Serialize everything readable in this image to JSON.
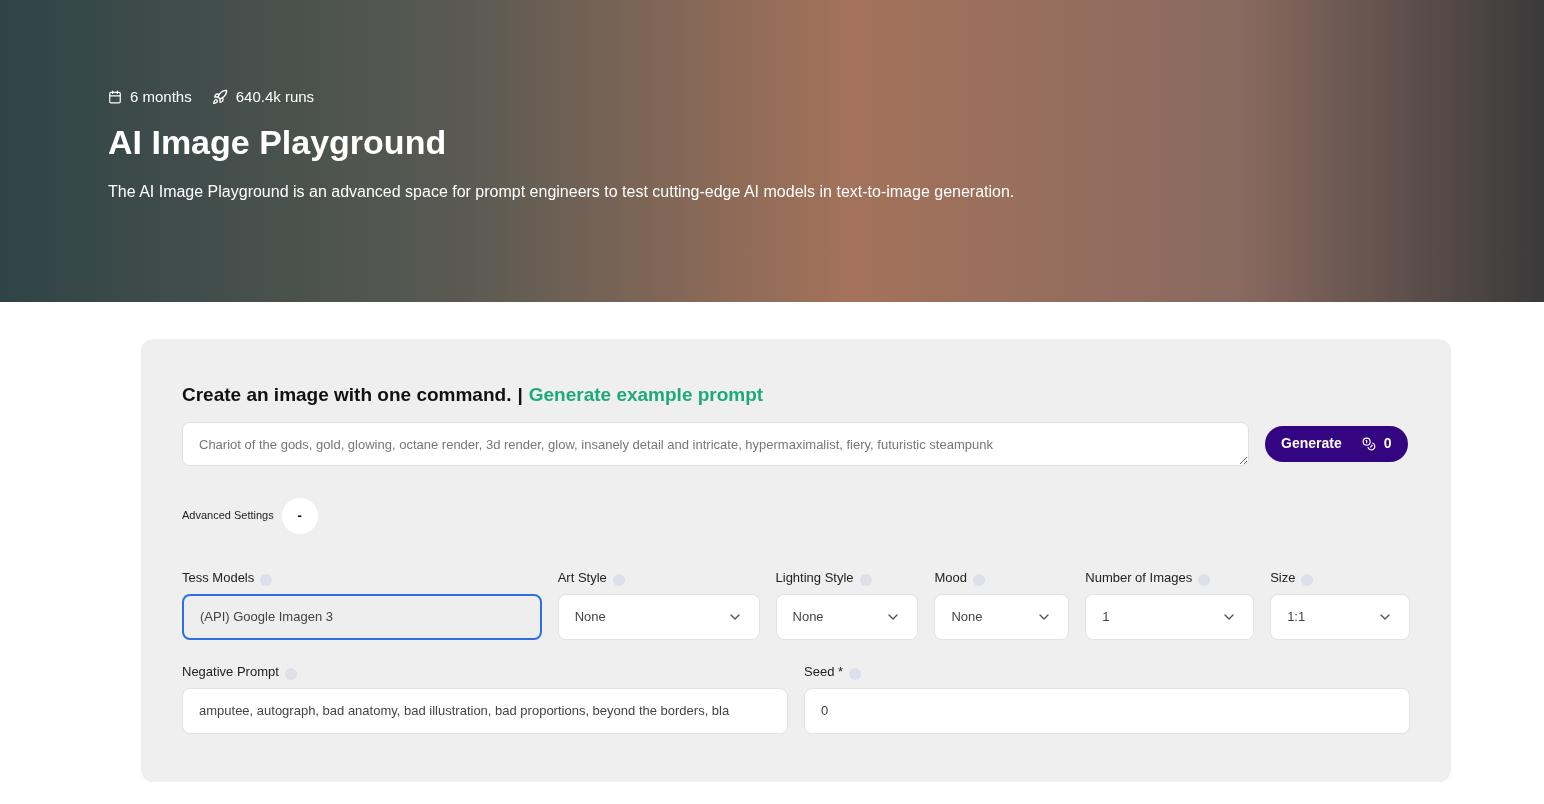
{
  "hero": {
    "stats": [
      {
        "kind": "calendar",
        "text": "6 months"
      },
      {
        "kind": "rocket",
        "text": "640.4k runs"
      }
    ],
    "title": "AI Image Playground",
    "description": "The AI Image Playground is an advanced space for prompt engineers to test cutting-edge AI models in text-to-image generation."
  },
  "form": {
    "heading": "Create an image with one command.",
    "separator": "|",
    "example_link": "Generate example prompt",
    "prompt": {
      "placeholder": "Chariot of the gods, gold, glowing, octane render, 3d render, glow, insanely detail and intricate, hypermaximalist, fiery, futuristic steampunk"
    },
    "generate_button": {
      "label": "Generate",
      "credits": "0"
    },
    "advanced": {
      "label": "Advanced Settings",
      "toggle": "-",
      "expanded": true
    },
    "fields": [
      {
        "kind": "text",
        "label": "Tess Models",
        "value": "(API) Google Imagen 3",
        "focused": true
      },
      {
        "kind": "select",
        "label": "Art Style",
        "value": "None",
        "focused": false
      },
      {
        "kind": "select",
        "label": "Lighting Style",
        "value": "None",
        "focused": false
      },
      {
        "kind": "select",
        "label": "Mood",
        "value": "None",
        "focused": false
      },
      {
        "kind": "select",
        "label": "Number of Images",
        "value": "1",
        "focused": false
      },
      {
        "kind": "select",
        "label": "Size",
        "value": "1:1",
        "focused": false
      }
    ],
    "negative_prompt": {
      "label": "Negative Prompt",
      "value": "amputee, autograph, bad anatomy, bad illustration, bad proportions, beyond the borders, bla"
    },
    "seed": {
      "label": "Seed *",
      "value": "0"
    }
  }
}
